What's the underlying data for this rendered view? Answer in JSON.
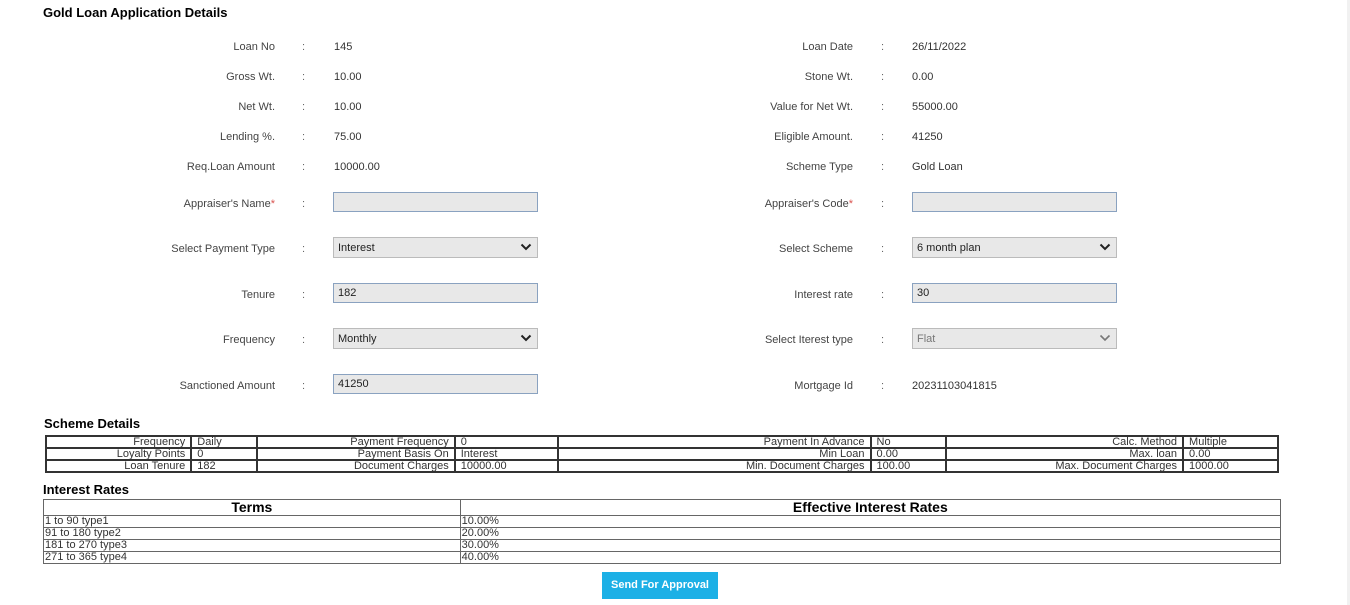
{
  "page_title": "Gold Loan Application Details",
  "left_fields": [
    {
      "label": "Loan No",
      "value": "145"
    },
    {
      "label": "Gross Wt.",
      "value": "10.00"
    },
    {
      "label": "Net Wt.",
      "value": "10.00"
    },
    {
      "label": "Lending %.",
      "value": "75.00"
    },
    {
      "label": "Req.Loan Amount",
      "value": "10000.00"
    }
  ],
  "right_fields": [
    {
      "label": "Loan Date",
      "value": "26/11/2022"
    },
    {
      "label": "Stone Wt.",
      "value": "0.00"
    },
    {
      "label": "Value for Net Wt.",
      "value": "55000.00"
    },
    {
      "label": "Eligible Amount.",
      "value": "41250"
    },
    {
      "label": "Scheme Type",
      "value": "Gold Loan"
    }
  ],
  "colon": ":",
  "required_mark": "*",
  "form": {
    "appraiser_name_label": "Appraiser's Name",
    "appraiser_name_value": "",
    "appraiser_code_label": "Appraiser's Code",
    "appraiser_code_value": "",
    "payment_type_label": "Select Payment Type",
    "payment_type_value": "Interest",
    "scheme_label": "Select Scheme",
    "scheme_value": "6 month plan",
    "tenure_label": "Tenure",
    "tenure_value": "182",
    "interest_rate_label": "Interest rate",
    "interest_rate_value": "30",
    "frequency_label": "Frequency",
    "frequency_value": "Monthly",
    "interest_type_label": "Select Iterest type",
    "interest_type_value": "Flat",
    "sanctioned_amount_label": "Sanctioned Amount",
    "sanctioned_amount_value": "41250",
    "mortgage_id_label": "Mortgage Id",
    "mortgage_id_value": "20231103041815"
  },
  "scheme_details": {
    "title": "Scheme Details",
    "rows": [
      [
        [
          "Frequency",
          "Daily"
        ],
        [
          "Payment Frequency",
          "0"
        ],
        [
          "Payment In Advance",
          "No"
        ],
        [
          "Calc. Method",
          "Multiple"
        ]
      ],
      [
        [
          "Loyalty Points",
          "0"
        ],
        [
          "Payment Basis On",
          "Interest"
        ],
        [
          "Min Loan",
          "0.00"
        ],
        [
          "Max. loan",
          "0.00"
        ]
      ],
      [
        [
          "Loan Tenure",
          "182"
        ],
        [
          "Document Charges",
          "10000.00"
        ],
        [
          "Min. Document Charges",
          "100.00"
        ],
        [
          "Max. Document Charges",
          "1000.00"
        ]
      ]
    ]
  },
  "interest_rates": {
    "title": "Interest Rates",
    "headers": [
      "Terms",
      "Effective Interest Rates"
    ],
    "rows": [
      [
        "1 to 90 type1",
        "10.00%"
      ],
      [
        "91 to 180 type2",
        "20.00%"
      ],
      [
        "181 to 270 type3",
        "30.00%"
      ],
      [
        "271 to 365 type4",
        "40.00%"
      ]
    ]
  },
  "send_button_label": "Send For Approval",
  "icons": {
    "dropdown": "chevron-down-icon"
  },
  "colors": {
    "button": "#1cb0e6",
    "required": "#d9534f",
    "input_bg": "#e8e8e8"
  }
}
